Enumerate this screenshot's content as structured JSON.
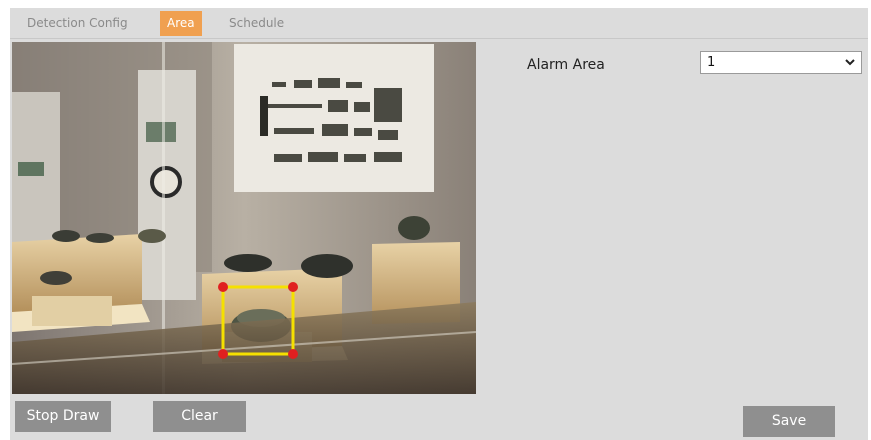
{
  "tabs": {
    "detection_config": "Detection Config",
    "area": "Area",
    "schedule": "Schedule",
    "active": "Area"
  },
  "alarm_area": {
    "label": "Alarm Area",
    "selected": "1"
  },
  "buttons": {
    "stop_draw": "Stop Draw",
    "clear": "Clear",
    "save": "Save"
  },
  "colors": {
    "active_tab": "#f0a050",
    "button": "#8f8f8f",
    "area_outline": "#f5e000",
    "area_handle": "#e02020"
  }
}
